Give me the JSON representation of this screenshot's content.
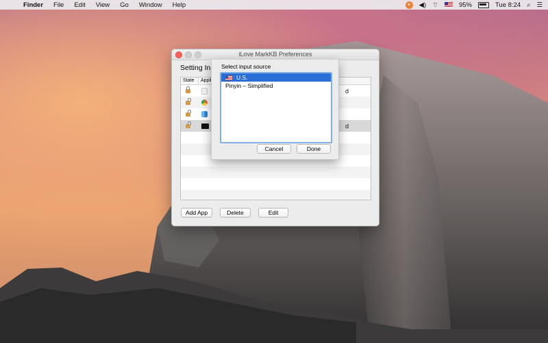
{
  "menubar": {
    "apple_glyph": "",
    "items": [
      "Finder",
      "File",
      "Edit",
      "View",
      "Go",
      "Window",
      "Help"
    ],
    "battery": "95%",
    "clock": "Tue 8:24",
    "icons": [
      "app-tray-icon",
      "volume-icon",
      "wifi-icon",
      "input-flag-icon",
      "battery-icon",
      "search-icon",
      "list-icon"
    ]
  },
  "window": {
    "title": "iLove MarkKB Preferences",
    "setting_label": "Setting Inp",
    "columns": [
      "State",
      "Applic"
    ],
    "rows": [
      {
        "lock": "locked",
        "app_icon": "document-icon",
        "trail": "d"
      },
      {
        "lock": "unlocked",
        "app_icon": "chrome-icon",
        "trail": ""
      },
      {
        "lock": "unlocked",
        "app_icon": "finder-icon",
        "trail": ""
      },
      {
        "lock": "unlocked",
        "app_icon": "terminal-icon",
        "trail": "d",
        "selected": true
      }
    ],
    "buttons": {
      "add": "Add App",
      "delete": "Delete",
      "edit": "Edit"
    }
  },
  "sheet": {
    "title": "Select input source",
    "options": [
      {
        "label": "U.S.",
        "flag": "us-flag-icon",
        "selected": true
      },
      {
        "label": "Pinyin – Simplified",
        "flag": "",
        "selected": false
      }
    ],
    "cancel": "Cancel",
    "done": "Done"
  },
  "colors": {
    "selection": "#2a6fd8",
    "focus_ring": "#7fb0e6",
    "close": "#fc605b"
  }
}
